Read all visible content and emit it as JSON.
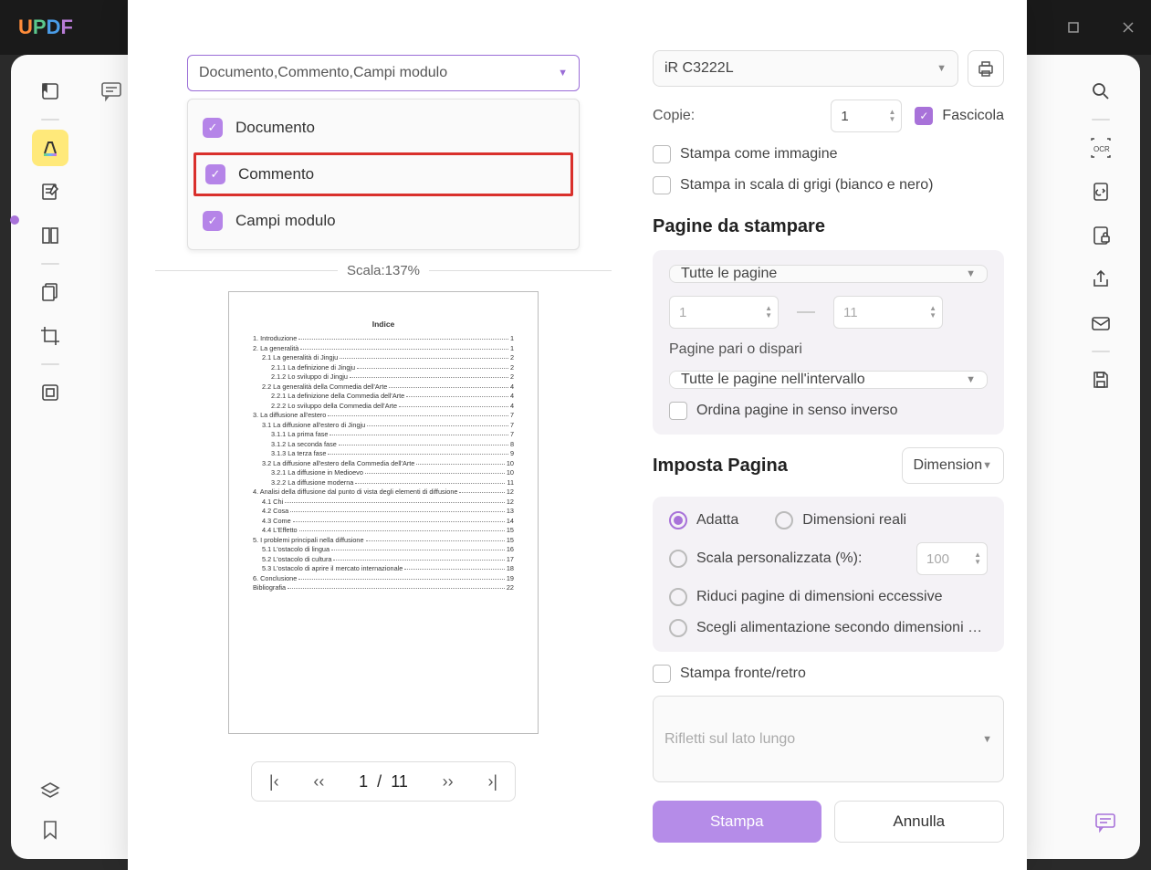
{
  "app": {
    "logo": "UPDF"
  },
  "window": {
    "min": "—",
    "max": "□",
    "close": "✕"
  },
  "print": {
    "combo_label": "Documento,Commento,Campi modulo",
    "dropdown": {
      "documento": "Documento",
      "commento": "Commento",
      "campi": "Campi modulo"
    },
    "scale": "Scala:137%",
    "preview_title": "Indice",
    "toc": [
      {
        "t": "1. Introduzione",
        "p": "1",
        "i": 0
      },
      {
        "t": "2. La generalità",
        "p": "1",
        "i": 0
      },
      {
        "t": "2.1 La generalità di Jingju",
        "p": "2",
        "i": 1
      },
      {
        "t": "2.1.1 La definizione di Jingju",
        "p": "2",
        "i": 2
      },
      {
        "t": "2.1.2 Lo sviluppo di Jingju",
        "p": "2",
        "i": 2
      },
      {
        "t": "2.2 La generalità della Commedia dell'Arte",
        "p": "4",
        "i": 1
      },
      {
        "t": "2.2.1 La definizione della Commedia dell'Arte",
        "p": "4",
        "i": 2
      },
      {
        "t": "2.2.2 Lo sviluppo della Commedia dell'Arte",
        "p": "4",
        "i": 2
      },
      {
        "t": "3. La diffusione all'estero",
        "p": "7",
        "i": 0
      },
      {
        "t": "3.1 La diffusione all'estero di Jingju",
        "p": "7",
        "i": 1
      },
      {
        "t": "3.1.1 La prima fase",
        "p": "7",
        "i": 2
      },
      {
        "t": "3.1.2 La seconda fase",
        "p": "8",
        "i": 2
      },
      {
        "t": "3.1.3 La terza fase",
        "p": "9",
        "i": 2
      },
      {
        "t": "3.2 La diffusione all'estero della Commedia dell'Arte",
        "p": "10",
        "i": 1
      },
      {
        "t": "3.2.1 La diffusione in Medioevo",
        "p": "10",
        "i": 2
      },
      {
        "t": "3.2.2 La diffusione moderna",
        "p": "11",
        "i": 2
      },
      {
        "t": "4. Analisi della diffusione dal punto di vista degli elementi di diffusione",
        "p": "12",
        "i": 0
      },
      {
        "t": "4.1 Chi",
        "p": "12",
        "i": 1
      },
      {
        "t": "4.2 Cosa",
        "p": "13",
        "i": 1
      },
      {
        "t": "4.3 Come",
        "p": "14",
        "i": 1
      },
      {
        "t": "4.4 L'Effetto",
        "p": "15",
        "i": 1
      },
      {
        "t": "5. I problemi principali nella diffusione",
        "p": "15",
        "i": 0
      },
      {
        "t": "5.1 L'ostacolo di lingua",
        "p": "16",
        "i": 1
      },
      {
        "t": "5.2 L'ostacolo di cultura",
        "p": "17",
        "i": 1
      },
      {
        "t": "5.3 L'ostacolo di aprire il mercato internazionale",
        "p": "18",
        "i": 1
      },
      {
        "t": "6. Conclusione",
        "p": "19",
        "i": 0
      },
      {
        "t": "Bibliografia",
        "p": "22",
        "i": 0
      }
    ],
    "pager": {
      "current": "1",
      "sep": "/",
      "total": "11"
    },
    "printer": "iR C3222L",
    "copies_label": "Copie:",
    "copies_value": "1",
    "collate": "Fascicola",
    "print_as_image": "Stampa come immagine",
    "grayscale": "Stampa in scala di grigi (bianco e nero)",
    "pages_h": "Pagine da stampare",
    "pages_range": "Tutte le pagine",
    "range_from": "1",
    "range_to": "11",
    "odd_even_label": "Pagine pari o dispari",
    "odd_even_value": "Tutte le pagine nell'intervallo",
    "reverse": "Ordina pagine in senso inverso",
    "page_setup_h": "Imposta Pagina",
    "size_sel": "Dimension",
    "fit": "Adatta",
    "actual": "Dimensioni reali",
    "custom_scale": "Scala personalizzata (%):",
    "custom_scale_val": "100",
    "shrink": "Riduci pagine di dimensioni eccessive",
    "choose_source": "Scegli alimentazione secondo dimensioni …",
    "duplex": "Stampa fronte/retro",
    "flip": "Rifletti sul lato lungo",
    "print_btn": "Stampa",
    "cancel_btn": "Annulla"
  }
}
